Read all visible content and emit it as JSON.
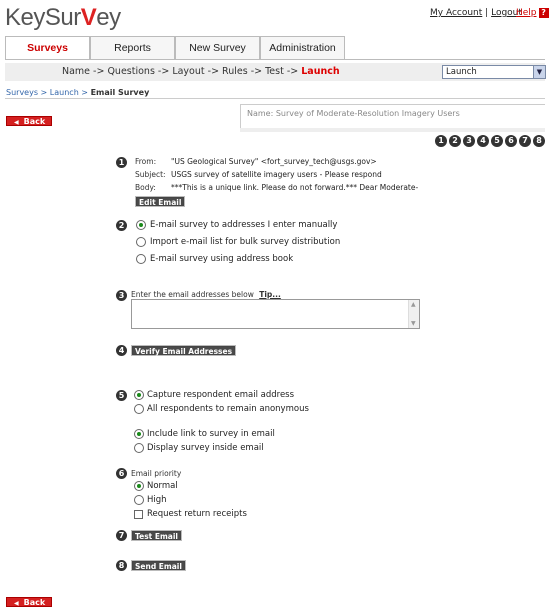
{
  "header": {
    "logo_left": "KeySur",
    "logo_mark": "V",
    "logo_right": "ey",
    "my_account": "My Account",
    "separator": "|",
    "logout": "Logout",
    "help": "Help",
    "help_badge": "?"
  },
  "tabs": [
    {
      "label": "Surveys",
      "active": true
    },
    {
      "label": "Reports",
      "active": false
    },
    {
      "label": "New Survey",
      "active": false
    },
    {
      "label": "Administration",
      "active": false
    }
  ],
  "wizard": {
    "steps_text": "Name -> Questions -> Layout -> Rules -> Test -> ",
    "current": "Launch",
    "select_value": "Launch"
  },
  "breadcrumb": {
    "surveys": "Surveys",
    "sep1": " > ",
    "launch": "Launch",
    "sep2": " > ",
    "current": "Email Survey"
  },
  "back_label": "Back",
  "survey_name": "Name: Survey of Moderate-Resolution Imagery Users",
  "step_numbers": [
    "1",
    "2",
    "3",
    "4",
    "5",
    "6",
    "7",
    "8"
  ],
  "email": {
    "from_label": "From:",
    "from_value": "\"US Geological Survey\" <fort_survey_tech@usgs.gov>",
    "subject_label": "Subject:",
    "subject_value": "USGS survey of satellite imagery users - Please respond",
    "body_label": "Body:",
    "body_value": "***This is a unique link. Please do not forward.*** Dear Moderate-",
    "edit_button": "Edit Email"
  },
  "distribution_options": [
    {
      "label": "E-mail survey to addresses I enter manually",
      "selected": true
    },
    {
      "label": "Import e-mail list for bulk survey distribution",
      "selected": false
    },
    {
      "label": "E-mail survey using address book",
      "selected": false
    }
  ],
  "addresses": {
    "label": "Enter the email addresses below",
    "tip": "Tip...",
    "value": ""
  },
  "verify_button": "Verify Email Addresses",
  "respondent_options": [
    {
      "label": "Capture respondent email address",
      "selected": true
    },
    {
      "label": "All respondents to remain anonymous",
      "selected": false
    }
  ],
  "link_options": [
    {
      "label": "Include link to survey in email",
      "selected": true
    },
    {
      "label": "Display survey inside email",
      "selected": false
    }
  ],
  "priority": {
    "label": "Email priority",
    "options": [
      {
        "label": "Normal",
        "selected": true
      },
      {
        "label": "High",
        "selected": false
      }
    ],
    "receipts_label": "Request return receipts",
    "receipts_checked": false
  },
  "test_button": "Test Email",
  "send_button": "Send Email",
  "colors": {
    "accent": "#cc0000",
    "selected_radio": "#1a8a1a",
    "button_dark": "#4a4a4a"
  }
}
